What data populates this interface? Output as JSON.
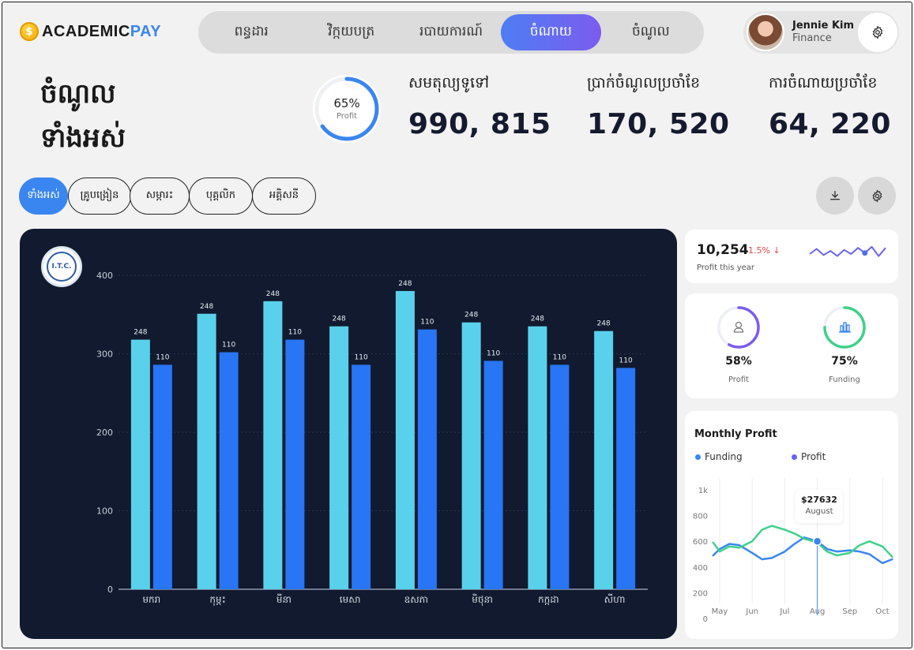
{
  "app": {
    "logo_prefix": "ACADEMIC",
    "logo_suffix": "PAY",
    "coin_symbol": "$"
  },
  "nav": {
    "items": [
      {
        "label": "ពន្ធដារ"
      },
      {
        "label": "វិក្កយបត្រ"
      },
      {
        "label": "របាយការណ៍"
      },
      {
        "label": "ចំណាយ"
      },
      {
        "label": "ចំណូល"
      }
    ],
    "active_index": 3
  },
  "profile": {
    "name": "Jennie Kim",
    "role": "Finance",
    "settings_icon": "gear-icon"
  },
  "header": {
    "title_line1": "ចំណូល",
    "title_line2": "ទាំងអស់"
  },
  "profit_ring": {
    "percent_label": "65%",
    "sublabel": "Profit",
    "value": 0.65
  },
  "stats": [
    {
      "label": "សមតុល្យទូទៅ",
      "value": "990, 815"
    },
    {
      "label": "ប្រាក់ចំណូលប្រចាំខែ",
      "value": "170, 520"
    },
    {
      "label": "ការចំណាយប្រចាំខែ",
      "value": "64, 220"
    }
  ],
  "filters": [
    {
      "label": "ទាំងអស់",
      "active": true
    },
    {
      "label": "គ្រូបង្រៀន",
      "active": false
    },
    {
      "label": "សម្ភារះ",
      "active": false
    },
    {
      "label": "បុគ្គលិក",
      "active": false
    },
    {
      "label": "អគ្គិសនី",
      "active": false
    }
  ],
  "toolbar": {
    "download_icon": "download-icon",
    "settings_icon": "gear-icon"
  },
  "seal": {
    "text": "I.T.C."
  },
  "chart_data": [
    {
      "type": "bar",
      "categories": [
        "មករា",
        "កុម្ភះ",
        "មីនា",
        "មេសា",
        "ឧសភា",
        "មិថុនា",
        "កក្កដា",
        "សីហា"
      ],
      "series": [
        {
          "values": [
            318,
            351,
            367,
            335,
            380,
            340,
            335,
            329
          ],
          "labels": [
            "248",
            "248",
            "248",
            "248",
            "248",
            "248",
            "248",
            "248"
          ],
          "color": "#5ad1ec"
        },
        {
          "values": [
            286,
            302,
            318,
            286,
            331,
            291,
            286,
            282
          ],
          "labels": [
            "110",
            "110",
            "110",
            "110",
            "110",
            "110",
            "110",
            "110"
          ],
          "color": "#2875f5"
        }
      ],
      "yticks": [
        "0",
        "100",
        "200",
        "300",
        "400"
      ],
      "ylim": [
        0,
        400
      ],
      "grid": true
    },
    {
      "type": "line",
      "title": "Monthly Profit",
      "x": [
        "May",
        "Jun",
        "Jul",
        "Aug",
        "Sep",
        "Oct"
      ],
      "yticks": [
        "0",
        "200",
        "400",
        "600",
        "800",
        "1k"
      ],
      "ylim": [
        0,
        1000
      ],
      "series": [
        {
          "name": "Funding",
          "color": "#3a86f0",
          "x": [
            4.8,
            5.0,
            5.3,
            5.6,
            6.0,
            6.3,
            6.6,
            7.0,
            7.3,
            7.6,
            8.0,
            8.3,
            8.6,
            9.0,
            9.3,
            9.6,
            10.0,
            10.3
          ],
          "values": [
            490,
            540,
            580,
            570,
            510,
            460,
            470,
            520,
            580,
            630,
            600,
            540,
            520,
            530,
            520,
            500,
            430,
            460
          ]
        },
        {
          "name": "Profit",
          "color": "#3fd18a",
          "x": [
            4.8,
            5.0,
            5.3,
            5.6,
            6.0,
            6.3,
            6.6,
            7.0,
            7.3,
            7.6,
            8.0,
            8.3,
            8.6,
            9.0,
            9.3,
            9.6,
            10.0,
            10.3
          ],
          "values": [
            590,
            520,
            560,
            550,
            600,
            690,
            720,
            690,
            660,
            620,
            590,
            520,
            490,
            510,
            570,
            600,
            560,
            480
          ]
        }
      ],
      "tooltip": {
        "value": "$27632",
        "label": "August"
      }
    }
  ],
  "summary": {
    "value": "10,254",
    "change": "1.5% ↓",
    "caption": "Profit this year",
    "sparkline": [
      0.5,
      0.25,
      0.55,
      0.35,
      0.6,
      0.3,
      0.5,
      0.2,
      0.45,
      0.15,
      0.6,
      0.2
    ]
  },
  "kpis": [
    {
      "percent": "58%",
      "label": "Profit",
      "value": 0.58,
      "icon": "user-icon",
      "color": "#7b5cf0"
    },
    {
      "percent": "75%",
      "label": "Funding",
      "value": 0.75,
      "icon": "bar-chart-icon",
      "color": "#3fd18a"
    }
  ],
  "colors": {
    "accent": "#3a86f0",
    "nav_gradient_start": "#4f7df3",
    "nav_gradient_end": "#7b5cf0",
    "panel": "#111a2e",
    "negative": "#e0464c"
  }
}
